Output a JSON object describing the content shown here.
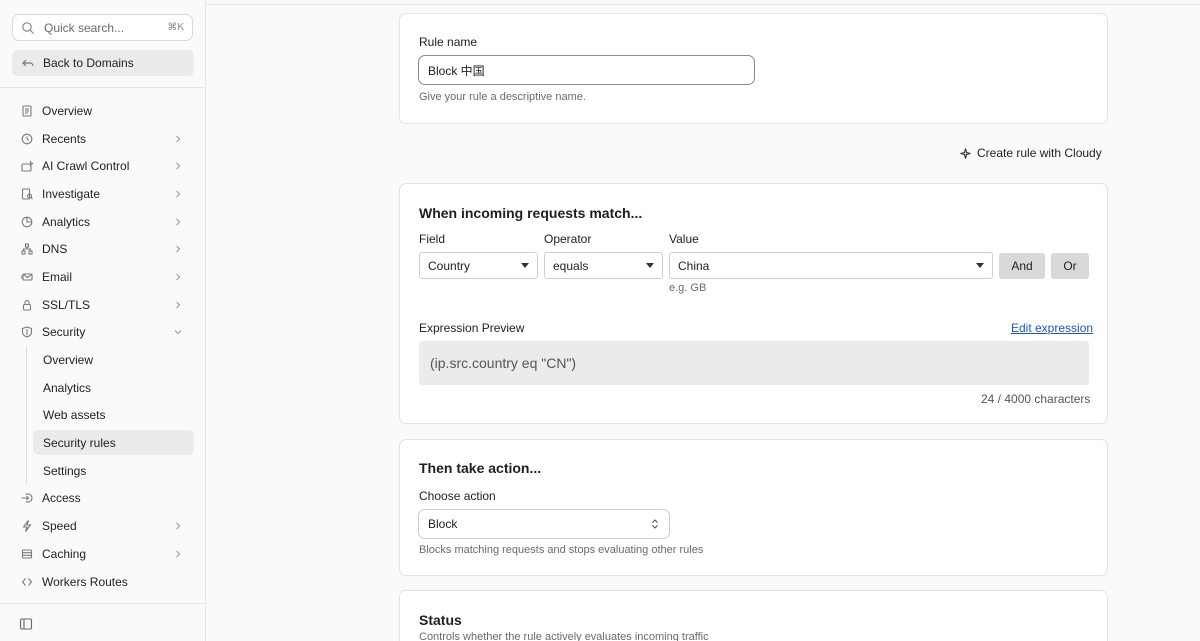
{
  "sidebar": {
    "search_placeholder": "Quick search...",
    "search_shortcut": "⌘K",
    "back_label": "Back to Domains",
    "items": [
      {
        "label": "Overview",
        "icon": "document-icon",
        "chevron": false
      },
      {
        "label": "Recents",
        "icon": "clock-icon",
        "chevron": true
      },
      {
        "label": "AI Crawl Control",
        "icon": "ai-crawl-icon",
        "chevron": true
      },
      {
        "label": "Investigate",
        "icon": "investigate-icon",
        "chevron": true
      },
      {
        "label": "Analytics",
        "icon": "analytics-icon",
        "chevron": true
      },
      {
        "label": "DNS",
        "icon": "dns-icon",
        "chevron": true
      },
      {
        "label": "Email",
        "icon": "email-icon",
        "chevron": true
      },
      {
        "label": "SSL/TLS",
        "icon": "lock-icon",
        "chevron": true
      },
      {
        "label": "Security",
        "icon": "shield-icon",
        "chevron": "down"
      }
    ],
    "security_sub": [
      {
        "label": "Overview"
      },
      {
        "label": "Analytics"
      },
      {
        "label": "Web assets"
      },
      {
        "label": "Security rules",
        "active": true
      },
      {
        "label": "Settings"
      }
    ],
    "items_after": [
      {
        "label": "Access",
        "icon": "access-icon",
        "chevron": false
      },
      {
        "label": "Speed",
        "icon": "speed-icon",
        "chevron": true
      },
      {
        "label": "Caching",
        "icon": "caching-icon",
        "chevron": true
      },
      {
        "label": "Workers Routes",
        "icon": "workers-icon",
        "chevron": false
      }
    ]
  },
  "rule_name": {
    "label": "Rule name",
    "value": "Block 中国",
    "help": "Give your rule a descriptive name."
  },
  "cloudy_label": "Create rule with Cloudy",
  "match": {
    "title": "When incoming requests match...",
    "field_label": "Field",
    "operator_label": "Operator",
    "value_label": "Value",
    "field_value": "Country",
    "operator_value": "equals",
    "value_value": "China",
    "value_hint": "e.g. GB",
    "and_label": "And",
    "or_label": "Or",
    "preview_label": "Expression Preview",
    "edit_label": "Edit expression",
    "expression": "(ip.src.country eq \"CN\")",
    "char_count": "24 / 4000 characters"
  },
  "action": {
    "title": "Then take action...",
    "choose_label": "Choose action",
    "value": "Block",
    "help": "Blocks matching requests and stops evaluating other rules"
  },
  "status": {
    "title": "Status",
    "help": "Controls whether the rule actively evaluates incoming traffic"
  }
}
